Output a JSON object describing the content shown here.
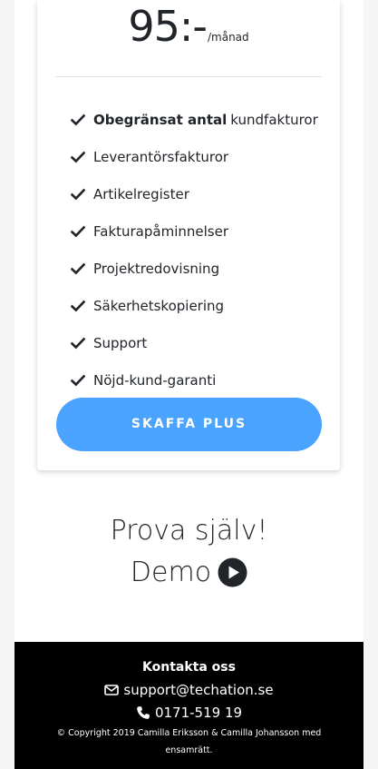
{
  "pricing": {
    "amount": "95:-",
    "unit": "/månad",
    "features": [
      {
        "bold": "Obegränsat antal",
        "text": "kundfakturor"
      },
      {
        "bold": "",
        "text": "Leverantörsfakturor"
      },
      {
        "bold": "",
        "text": "Artikelregister"
      },
      {
        "bold": "",
        "text": "Fakturapåminnelser"
      },
      {
        "bold": "",
        "text": "Projektredovisning"
      },
      {
        "bold": "",
        "text": "Säkerhetskopiering"
      },
      {
        "bold": "",
        "text": "Support"
      },
      {
        "bold": "",
        "text": "Nöjd-kund-garanti"
      }
    ],
    "cta_label": "SKAFFA PLUS"
  },
  "try_section": {
    "title": "Prova själv!",
    "demo_label": "Demo",
    "demo_icon": "play-circle-icon"
  },
  "footer": {
    "title": "Kontakta oss",
    "email": "support@techation.se",
    "email_icon": "envelope-icon",
    "phone": "0171-519 19",
    "phone_icon": "phone-icon",
    "copyright": "© Copyright 2019 Camilla Eriksson & Camilla Johansson med ensamrätt."
  },
  "colors": {
    "accent": "#4aa3ff",
    "footer_bg": "#000000",
    "text": "#212529"
  }
}
